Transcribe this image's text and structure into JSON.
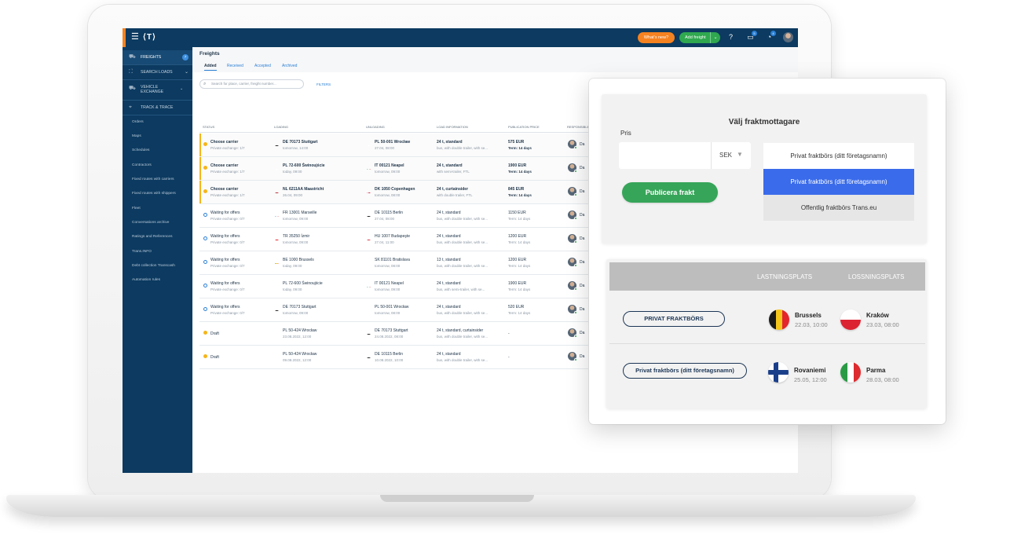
{
  "app": {
    "logo": "⟨T⟩",
    "whats_new": "What's new?",
    "add_freight": "Add freight",
    "badges": {
      "messages": "5",
      "notifications": "4"
    }
  },
  "sidebar": {
    "main_items": [
      {
        "label": "FREIGHTS",
        "badge": "7",
        "active": true
      },
      {
        "label": "SEARCH LOADS"
      },
      {
        "label": "VEHICLE EXCHANGE"
      },
      {
        "label": "TRACK & TRACE"
      }
    ],
    "sub_items": [
      "Orders",
      "Maps",
      "Schedules",
      "Contractors",
      "Fixed routes with carriers",
      "Fixed routes with shippers",
      "Fleet",
      "Conversations archive",
      "Ratings and References",
      "Trans.INFO",
      "Debt collection Transcash",
      "Automation rules"
    ]
  },
  "freights": {
    "title": "Freights",
    "tabs": [
      "Added",
      "Received",
      "Accepted",
      "Archived"
    ],
    "search_placeholder": "Search for place, carrier, freight number...",
    "filters_label": "FILTERS",
    "columns": [
      "STATUS",
      "LOADING",
      "UNLOADING",
      "LOAD INFORMATION",
      "PUBLICATION PRICE",
      "RESPONSIBLE"
    ],
    "rows": [
      {
        "status": "Choose carrier",
        "status_sub": "Private exchange: 1/7",
        "load": "DE 70173 Stuttgart",
        "load_date": "tomorrow, 14:00",
        "unload": "PL 50-001 Wrocław",
        "unload_date": "27.04, 08:00",
        "info": "24 t, standard",
        "info_sub": "bus, with double trailer, with se...",
        "price": "575 EUR",
        "term": "Term: 14 days",
        "resp": "Da"
      },
      {
        "status": "Choose carrier",
        "status_sub": "Private exchange: 1/7",
        "load": "PL 72-600 Świnoujście",
        "load_date": "today, 09:00",
        "unload": "IT 00121 Neapel",
        "unload_date": "tomorrow, 09:00",
        "info": "24 t, standard",
        "info_sub": "with semi-trailer, FTL",
        "price": "1900 EUR",
        "term": "Term: 14 days",
        "resp": "Da"
      },
      {
        "status": "Choose carrier",
        "status_sub": "Private exchange: 1/7",
        "load": "NL 6211AA Maastricht",
        "load_date": "26.04, 09:00",
        "unload": "DK 1050 Copenhagen",
        "unload_date": "tomorrow, 08:00",
        "info": "24 t, curtainsider",
        "info_sub": "with double trailer, FTL",
        "price": "845 EUR",
        "term": "Term: 14 days",
        "resp": "Da"
      },
      {
        "status": "Waiting for offers",
        "status_sub": "Private exchange: 0/7",
        "load": "FR 13001 Marseille",
        "load_date": "tomorrow, 09:00",
        "unload": "DE 10115 Berlin",
        "unload_date": "27.04, 08:00",
        "info": "24 t, standard",
        "info_sub": "bus, with double trailer, with se...",
        "price": "1150 EUR",
        "term": "Term: 14 days",
        "resp": "Da"
      },
      {
        "status": "Waiting for offers",
        "status_sub": "Private exchange: 0/7",
        "load": "TR 35250 İzmir",
        "load_date": "tomorrow, 09:00",
        "unload": "HU 1007 Budapeşte",
        "unload_date": "27.04, 11:00",
        "info": "24 t, standard",
        "info_sub": "bus, with double trailer, with se...",
        "price": "1200 EUR",
        "term": "Term: 14 days",
        "resp": "Da"
      },
      {
        "status": "Waiting for offers",
        "status_sub": "Private exchange: 0/7",
        "load": "BE 1000 Brussels",
        "load_date": "today, 09:00",
        "unload": "SK 81101 Bratislava",
        "unload_date": "tomorrow, 08:00",
        "info": "13 t, standard",
        "info_sub": "bus, with double trailer, with se...",
        "price": "1200 EUR",
        "term": "Term: 14 days",
        "resp": "Da"
      },
      {
        "status": "Waiting for offers",
        "status_sub": "Private exchange: 0/7",
        "load": "PL 72-600 Świnoujście",
        "load_date": "today, 09:00",
        "unload": "IT 00121 Neapel",
        "unload_date": "tomorrow, 09:00",
        "info": "24 t, standard",
        "info_sub": "bus, with semi-trailer, with se...",
        "price": "1900 EUR",
        "term": "Term: 14 days",
        "resp": "Da"
      },
      {
        "status": "Waiting for offers",
        "status_sub": "Private exchange: 0/7",
        "load": "DE 70173 Stuttgart",
        "load_date": "tomorrow, 09:00",
        "unload": "PL 50-001 Wrocław",
        "unload_date": "tomorrow, 08:00",
        "info": "24 t, standard",
        "info_sub": "bus, with double trailer, with se...",
        "price": "520 EUR",
        "term": "Term: 14 days",
        "resp": "Da"
      },
      {
        "status": "Draft",
        "status_sub": "",
        "load": "PL 50-424 Wrocław",
        "load_date": "23.08.2022, 12:00",
        "unload": "DE 70173 Stuttgart",
        "unload_date": "24.08.2022, 08:00",
        "info": "24 t, standard, curtainsider",
        "info_sub": "bus, with double trailer, with se...",
        "price": "-",
        "term": "",
        "resp": "Da"
      },
      {
        "status": "Draft",
        "status_sub": "",
        "load": "PL 50-424 Wrocław",
        "load_date": "09.08.2022, 12:00",
        "unload": "DE 10115 Berlin",
        "unload_date": "10.08.2022, 10:00",
        "info": "24 t, standard",
        "info_sub": "bus, with double trailer, with se...",
        "price": "-",
        "term": "",
        "resp": "Da"
      }
    ]
  },
  "overlay": {
    "title": "Välj fraktmottagare",
    "pris_label": "Pris",
    "currency": "SEK",
    "publish_label": "Publicera frakt",
    "options": [
      "Privat fraktbörs (ditt företagsnamn)",
      "Privat fraktbörs (ditt företagsnamn)",
      "Offentlig fraktbörs Trans.eu"
    ],
    "table_headers": [
      "LASTNINGSPLATS",
      "LOSSNINGSPLATS"
    ],
    "routes": [
      {
        "button": "PRIVAT FRAKTBÖRS",
        "from_city": "Brussels",
        "from_date": "22.03, 10:00",
        "to_city": "Kraków",
        "to_date": "23.03, 08:00"
      },
      {
        "button": "Privat fraktbörs (ditt företagsnamn)",
        "from_city": "Rovaniemi",
        "from_date": "25.05, 12:00",
        "to_city": "Parma",
        "to_date": "28.03, 08:00"
      }
    ]
  }
}
